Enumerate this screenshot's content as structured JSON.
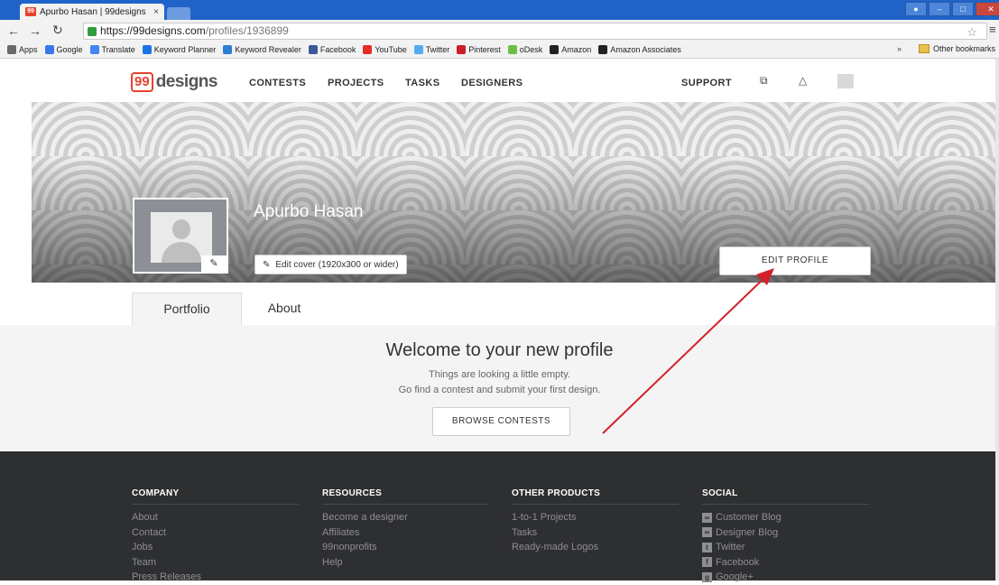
{
  "browser": {
    "tab_title": "Apurbo Hasan | 99designs",
    "tab_favicon": "99",
    "tab_close": "×",
    "url_host": "https://99designs.com",
    "url_path": "/profiles/1936899",
    "bookmarks": [
      {
        "label": "Apps",
        "icon": "apps-icon",
        "color": "#6a6a6a"
      },
      {
        "label": "Google",
        "icon": "google-icon",
        "color": "#3b78e7"
      },
      {
        "label": "Translate",
        "icon": "translate-icon",
        "color": "#4285f4"
      },
      {
        "label": "Keyword Planner",
        "icon": "keyword-planner-icon",
        "color": "#1a73e8"
      },
      {
        "label": "Keyword Revealer",
        "icon": "keyword-revealer-icon",
        "color": "#2d7dd2"
      },
      {
        "label": "Facebook",
        "icon": "facebook-icon",
        "color": "#3b5998"
      },
      {
        "label": "YouTube",
        "icon": "youtube-icon",
        "color": "#e52d27"
      },
      {
        "label": "Twitter",
        "icon": "twitter-icon",
        "color": "#55acee"
      },
      {
        "label": "Pinterest",
        "icon": "pinterest-icon",
        "color": "#cb2027"
      },
      {
        "label": "oDesk",
        "icon": "odesk-icon",
        "color": "#6fbe44"
      },
      {
        "label": "Amazon",
        "icon": "amazon-icon",
        "color": "#222222"
      },
      {
        "label": "Amazon Associates",
        "icon": "amazon-icon",
        "color": "#222222"
      }
    ],
    "bookmarks_overflow": "»",
    "other_bookmarks": "Other bookmarks"
  },
  "site": {
    "logo_99": "99",
    "logo_word": "designs",
    "nav": [
      "CONTESTS",
      "PROJECTS",
      "TASKS",
      "DESIGNERS"
    ],
    "support": "SUPPORT"
  },
  "profile": {
    "name": "Apurbo Hasan",
    "edit_cover": "Edit cover (1920x300 or wider)",
    "edit_profile": "EDIT PROFILE"
  },
  "tabs": [
    "Portfolio",
    "About"
  ],
  "welcome": {
    "title": "Welcome to your new profile",
    "line1": "Things are looking a little empty.",
    "line2": "Go find a contest and submit your first design.",
    "button": "BROWSE CONTESTS"
  },
  "footer": {
    "columns": [
      {
        "heading": "COMPANY",
        "links": [
          "About",
          "Contact",
          "Jobs",
          "Team",
          "Press Releases"
        ]
      },
      {
        "heading": "RESOURCES",
        "links": [
          "Become a designer",
          "Affiliates",
          "99nonprofits",
          "Help"
        ]
      },
      {
        "heading": "OTHER PRODUCTS",
        "links": [
          "1-to-1 Projects",
          "Tasks",
          "Ready-made Logos"
        ]
      },
      {
        "heading": "SOCIAL",
        "links": [
          "Customer Blog",
          "Designer Blog",
          "Twitter",
          "Facebook",
          "Google+"
        ]
      }
    ]
  },
  "colors": {
    "brand": "#e8412c",
    "annotation_arrow": "#d4202a",
    "footer_bg": "#2e2f31"
  }
}
